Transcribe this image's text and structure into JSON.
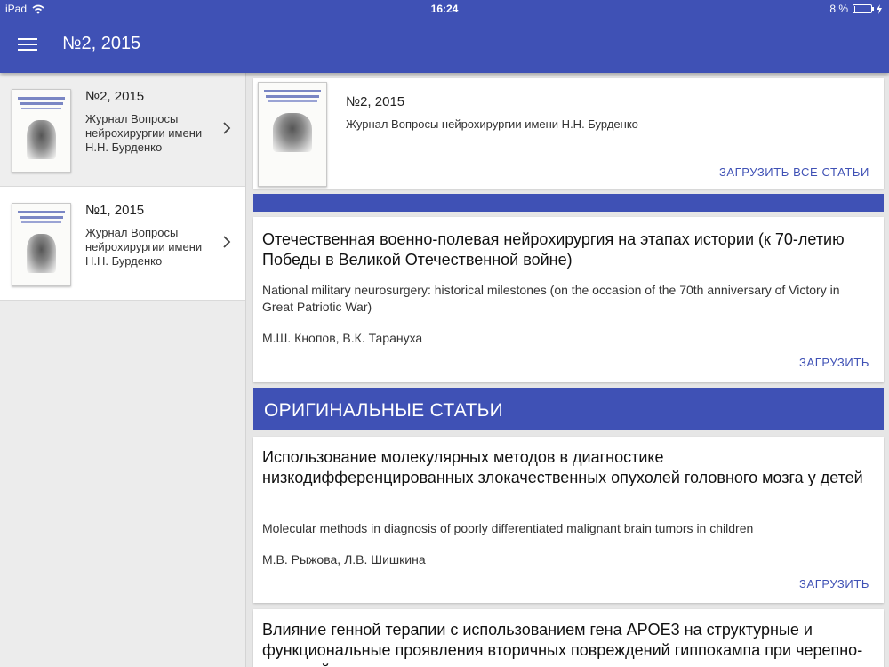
{
  "status_bar": {
    "device": "iPad",
    "time": "16:24",
    "battery": "8 %",
    "battery_level": 0.08
  },
  "app_bar": {
    "title": "№2, 2015"
  },
  "sidebar": {
    "issues": [
      {
        "number": "№2, 2015",
        "journal": "Журнал Вопросы нейрохирургии имени Н.Н. Бурденко"
      },
      {
        "number": "№1, 2015",
        "journal": "Журнал Вопросы нейрохирургии имени Н.Н. Бурденко"
      }
    ]
  },
  "issue_header": {
    "number": "№2, 2015",
    "journal": "Журнал Вопросы нейрохирургии имени Н.Н. Бурденко",
    "download_all": "ЗАГРУЗИТЬ ВСЕ СТАТЬИ"
  },
  "section_original": "ОРИГИНАЛЬНЫЕ СТАТЬИ",
  "articles": [
    {
      "title": "Отечественная военно-полевая нейрохирургия на этапах истории (к 70-летию Победы в Великой Отечественной войне)",
      "title_en": "National military neurosurgery: historical milestones (on the occasion of the 70th anniversary of Victory in Great Patriotic War)",
      "authors": "М.Ш. Кнопов, В.К. Тарануха",
      "download": "ЗАГРУЗИТЬ"
    },
    {
      "title": "Использование молекулярных методов в диагностике низкодифференцированных злокачественных опухолей головного мозга у детей",
      "title_en": "Molecular methods in diagnosis of poorly differentiated malignant brain tumors in children",
      "authors": "М.В. Рыжова, Л.В. Шишкина",
      "download": "ЗАГРУЗИТЬ"
    },
    {
      "title": "Влияние генной терапии с использованием гена APOE3 на структурные и функциональные проявления вторичных повреждений гиппокампа при черепно-мозговой травме в эксперименте"
    }
  ],
  "colors": {
    "primary": "#3f51b5",
    "background": "#e6e6e6"
  }
}
